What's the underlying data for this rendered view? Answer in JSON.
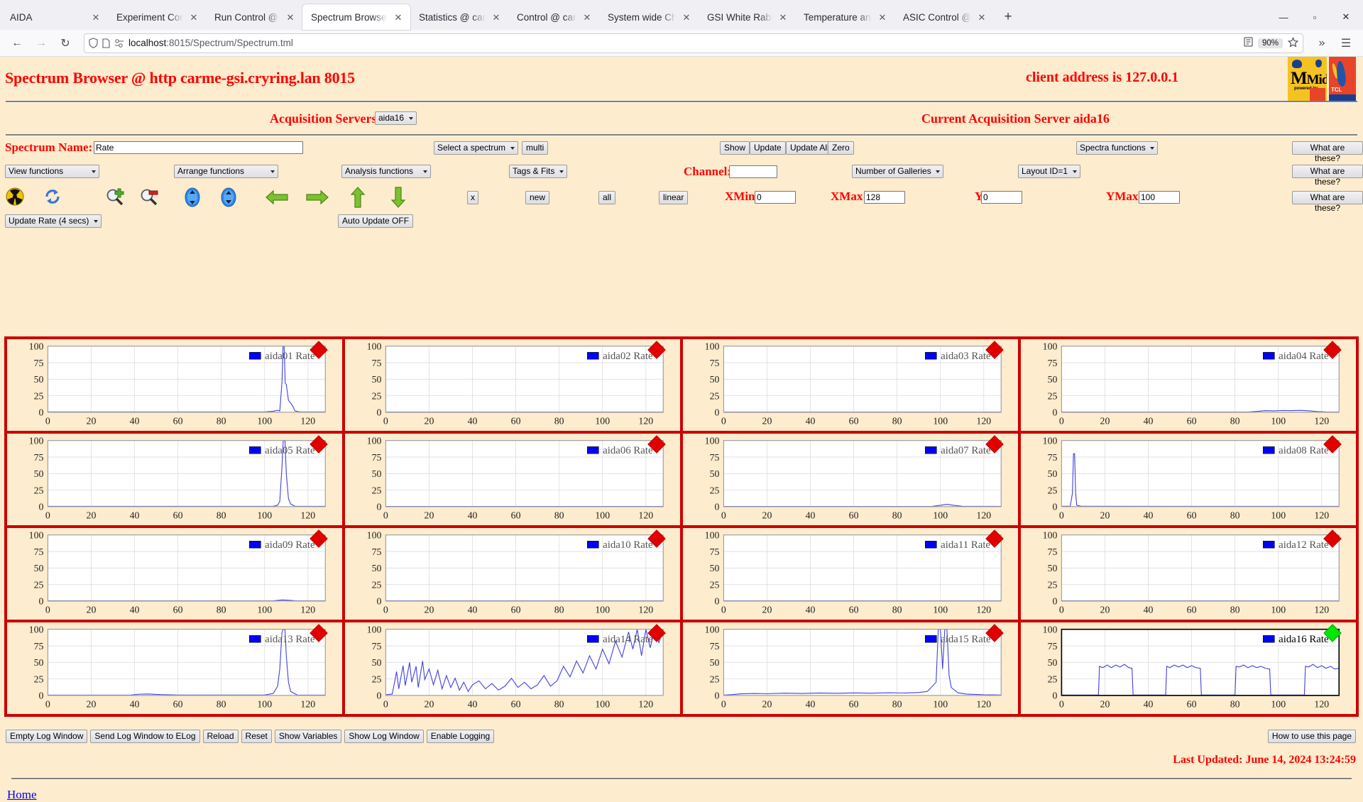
{
  "browser": {
    "tabs": [
      {
        "label": "AIDA",
        "active": false
      },
      {
        "label": "Experiment Control @",
        "active": false
      },
      {
        "label": "Run Control @ carme",
        "active": false
      },
      {
        "label": "Spectrum Browser @",
        "active": true
      },
      {
        "label": "Statistics @ carme-gs",
        "active": false
      },
      {
        "label": "Control @ carme-gsi",
        "active": false
      },
      {
        "label": "System wide Checks (",
        "active": false
      },
      {
        "label": "GSI White Rabbit Tim",
        "active": false
      },
      {
        "label": "Temperature and stat",
        "active": false
      },
      {
        "label": "ASIC Control @ carm",
        "active": false
      }
    ],
    "newtab_label": "+",
    "window_buttons": {
      "minimize": "—",
      "maximize": "▫",
      "close": "✕"
    },
    "nav": {
      "back": "←",
      "forward": "→",
      "reload": "↻"
    },
    "url": {
      "scheme_host": "localhost",
      "path": ":8015/Spectrum/Spectrum.tml"
    },
    "zoom_level": "90%",
    "overflow": "»",
    "menu": "☰"
  },
  "header": {
    "title": "Spectrum Browser @ http carme-gsi.cryring.lan 8015",
    "client_address": "client address is 127.0.0.1",
    "logo_midas": "Midas",
    "logo_midas_sub": "powered by",
    "logo_tcl": "TCL"
  },
  "acq": {
    "label": "Acquisition Servers",
    "server_selected": "aida16",
    "server_options": [
      "aida16"
    ],
    "current_label": "Current Acquisition Server aida16"
  },
  "controls": {
    "spectrum_name_label": "Spectrum Name:",
    "spectrum_name_value": "Rate",
    "spectrum_name_placeholder": "",
    "select_spectrum": "Select a spectrum",
    "multi_label": "multi",
    "show_label": "Show",
    "update_label": "Update",
    "update_all_label": "Update All",
    "zero_label": "Zero",
    "spectra_functions": "Spectra functions",
    "what_are_these": "What are these?",
    "view_functions": "View functions",
    "arrange_functions": "Arrange functions",
    "analysis_functions": "Analysis functions",
    "tags_fits": "Tags & Fits",
    "channel_label": "Channel:",
    "channel_value": "",
    "number_of_galleries": "Number of Galleries",
    "layout_id": "Layout ID=1",
    "x_label": "x",
    "new_label": "new",
    "all_label": "all",
    "linear_label": "linear",
    "xmin_label": "XMin",
    "xmin_value": "0",
    "xmax_label": "XMax",
    "xmax_value": "128",
    "ymin_label": "YMin",
    "ymin_value": "0",
    "ymax_label": "YMax",
    "ymax_value": "100",
    "update_rate": "Update Rate (4 secs)",
    "auto_update": "Auto Update OFF"
  },
  "icons": [
    "radiation-icon",
    "refresh-icon",
    "zoom-in-icon",
    "zoom-out-icon",
    "expand-down-icon",
    "expand-up-icon",
    "arrow-left-icon",
    "arrow-right-icon",
    "arrow-up-icon",
    "arrow-down-icon"
  ],
  "footer": {
    "buttons": [
      "Empty Log Window",
      "Send Log Window to ELog",
      "Reload",
      "Reset",
      "Show Variables",
      "Show Log Window",
      "Enable Logging"
    ],
    "how_to_use": "How to use this page",
    "last_updated": "Last Updated: June 14, 2024 13:24:59",
    "home_link": "Home"
  },
  "chart_data": {
    "type": "line",
    "shared": {
      "xlabel": "",
      "ylabel": "",
      "xlim": [
        0,
        128
      ],
      "ylim": [
        0,
        100
      ],
      "xticks": [
        0,
        20,
        40,
        60,
        80,
        100,
        120
      ],
      "yticks": [
        0,
        25,
        50,
        75,
        100
      ],
      "grid": true,
      "series_color": "#4040e0",
      "legend_position": "top-right"
    },
    "panels": [
      {
        "title": "aida01 Rate",
        "marker": "red",
        "selected": false,
        "points": [
          [
            0,
            0.4
          ],
          [
            100,
            0.4
          ],
          [
            104,
            1.5
          ],
          [
            106,
            3
          ],
          [
            107,
            2
          ],
          [
            108,
            45
          ],
          [
            108.5,
            100
          ],
          [
            109,
            100
          ],
          [
            109.5,
            44
          ],
          [
            110,
            42
          ],
          [
            111,
            18
          ],
          [
            112,
            14
          ],
          [
            113,
            9
          ],
          [
            114,
            2
          ],
          [
            116,
            0.4
          ],
          [
            128,
            0.4
          ]
        ]
      },
      {
        "title": "aida02 Rate",
        "marker": "red",
        "selected": false,
        "points": [
          [
            0,
            0.3
          ],
          [
            128,
            0.3
          ]
        ]
      },
      {
        "title": "aida03 Rate",
        "marker": "red",
        "selected": false,
        "points": [
          [
            0,
            0.3
          ],
          [
            128,
            0.3
          ]
        ]
      },
      {
        "title": "aida04 Rate",
        "marker": "red",
        "selected": false,
        "points": [
          [
            0,
            0.3
          ],
          [
            86,
            0.3
          ],
          [
            90,
            1.2
          ],
          [
            94,
            2.4
          ],
          [
            98,
            2.0
          ],
          [
            102,
            2.6
          ],
          [
            106,
            2.4
          ],
          [
            110,
            2.8
          ],
          [
            114,
            2.2
          ],
          [
            118,
            1.0
          ],
          [
            122,
            0.4
          ],
          [
            128,
            0.3
          ]
        ]
      },
      {
        "title": "aida05 Rate",
        "marker": "red",
        "selected": false,
        "points": [
          [
            0,
            0.4
          ],
          [
            104,
            0.4
          ],
          [
            106,
            2
          ],
          [
            107,
            8
          ],
          [
            108,
            60
          ],
          [
            108.6,
            100
          ],
          [
            109.4,
            100
          ],
          [
            110,
            50
          ],
          [
            111,
            12
          ],
          [
            112,
            4
          ],
          [
            114,
            0.5
          ],
          [
            128,
            0.4
          ]
        ]
      },
      {
        "title": "aida06 Rate",
        "marker": "red",
        "selected": false,
        "points": [
          [
            0,
            0.3
          ],
          [
            128,
            0.3
          ]
        ]
      },
      {
        "title": "aida07 Rate",
        "marker": "red",
        "selected": false,
        "points": [
          [
            0,
            0.3
          ],
          [
            96,
            0.3
          ],
          [
            100,
            2.0
          ],
          [
            103,
            3.5
          ],
          [
            106,
            2.0
          ],
          [
            110,
            0.6
          ],
          [
            128,
            0.3
          ]
        ]
      },
      {
        "title": "aida08 Rate",
        "marker": "red",
        "selected": false,
        "points": [
          [
            0,
            0.5
          ],
          [
            4,
            0.5
          ],
          [
            5,
            20
          ],
          [
            5.5,
            80
          ],
          [
            6,
            80
          ],
          [
            6.5,
            20
          ],
          [
            7,
            2
          ],
          [
            9,
            0.5
          ],
          [
            128,
            0.4
          ]
        ]
      },
      {
        "title": "aida09 Rate",
        "marker": "red",
        "selected": false,
        "points": [
          [
            0,
            0.3
          ],
          [
            104,
            0.3
          ],
          [
            108,
            1.6
          ],
          [
            111,
            1.2
          ],
          [
            114,
            0.4
          ],
          [
            128,
            0.3
          ]
        ]
      },
      {
        "title": "aida10 Rate",
        "marker": "red",
        "selected": false,
        "points": [
          [
            0,
            0.3
          ],
          [
            128,
            0.3
          ]
        ]
      },
      {
        "title": "aida11 Rate",
        "marker": "red",
        "selected": false,
        "points": [
          [
            0,
            0.3
          ],
          [
            128,
            0.3
          ]
        ]
      },
      {
        "title": "aida12 Rate",
        "marker": "red",
        "selected": false,
        "points": [
          [
            0,
            0.3
          ],
          [
            128,
            0.3
          ]
        ]
      },
      {
        "title": "aida13 Rate",
        "marker": "red",
        "selected": false,
        "points": [
          [
            0,
            0.4
          ],
          [
            38,
            0.4
          ],
          [
            42,
            1.8
          ],
          [
            46,
            2.2
          ],
          [
            52,
            1.2
          ],
          [
            60,
            0.6
          ],
          [
            100,
            0.5
          ],
          [
            104,
            3
          ],
          [
            106,
            14
          ],
          [
            107,
            40
          ],
          [
            108,
            95
          ],
          [
            108.6,
            100
          ],
          [
            109.4,
            100
          ],
          [
            110,
            60
          ],
          [
            111,
            20
          ],
          [
            112,
            6
          ],
          [
            115,
            0.6
          ],
          [
            128,
            0.4
          ]
        ]
      },
      {
        "title": "aida14 Rate",
        "marker": "red",
        "selected": false,
        "points": [
          [
            0,
            1
          ],
          [
            3,
            2
          ],
          [
            5,
            36
          ],
          [
            6,
            10
          ],
          [
            8,
            45
          ],
          [
            9,
            15
          ],
          [
            11,
            50
          ],
          [
            12,
            20
          ],
          [
            14,
            44
          ],
          [
            15,
            12
          ],
          [
            17,
            52
          ],
          [
            18,
            24
          ],
          [
            20,
            40
          ],
          [
            22,
            16
          ],
          [
            24,
            38
          ],
          [
            26,
            10
          ],
          [
            28,
            30
          ],
          [
            30,
            12
          ],
          [
            32,
            26
          ],
          [
            34,
            8
          ],
          [
            36,
            20
          ],
          [
            38,
            6
          ],
          [
            40,
            16
          ],
          [
            43,
            22
          ],
          [
            46,
            10
          ],
          [
            49,
            18
          ],
          [
            52,
            8
          ],
          [
            55,
            14
          ],
          [
            58,
            26
          ],
          [
            61,
            12
          ],
          [
            64,
            20
          ],
          [
            67,
            10
          ],
          [
            70,
            16
          ],
          [
            73,
            30
          ],
          [
            76,
            14
          ],
          [
            79,
            22
          ],
          [
            82,
            44
          ],
          [
            85,
            28
          ],
          [
            88,
            52
          ],
          [
            91,
            34
          ],
          [
            94,
            60
          ],
          [
            97,
            40
          ],
          [
            100,
            70
          ],
          [
            103,
            48
          ],
          [
            106,
            82
          ],
          [
            109,
            58
          ],
          [
            112,
            96
          ],
          [
            114,
            70
          ],
          [
            116,
            100
          ],
          [
            118,
            60
          ],
          [
            120,
            100
          ],
          [
            122,
            72
          ],
          [
            124,
            100
          ],
          [
            126,
            80
          ],
          [
            128,
            100
          ]
        ]
      },
      {
        "title": "aida15 Rate",
        "marker": "red",
        "selected": false,
        "points": [
          [
            0,
            0.4
          ],
          [
            4,
            1.2
          ],
          [
            8,
            2.4
          ],
          [
            14,
            3.0
          ],
          [
            20,
            2.6
          ],
          [
            28,
            3.4
          ],
          [
            36,
            3.0
          ],
          [
            44,
            3.6
          ],
          [
            52,
            3.2
          ],
          [
            60,
            3.8
          ],
          [
            68,
            3.4
          ],
          [
            76,
            4.0
          ],
          [
            84,
            3.6
          ],
          [
            90,
            4.4
          ],
          [
            94,
            6
          ],
          [
            98,
            20
          ],
          [
            99,
            100
          ],
          [
            100,
            100
          ],
          [
            101,
            40
          ],
          [
            102,
            100
          ],
          [
            103,
            100
          ],
          [
            104,
            30
          ],
          [
            105,
            12
          ],
          [
            108,
            4
          ],
          [
            112,
            2
          ],
          [
            120,
            1
          ],
          [
            128,
            0.6
          ]
        ]
      },
      {
        "title": "aida16 Rate",
        "marker": "green",
        "selected": true,
        "points": [
          [
            0,
            0.5
          ],
          [
            17,
            0.5
          ],
          [
            17.5,
            44
          ],
          [
            19,
            42
          ],
          [
            21,
            46
          ],
          [
            23,
            42
          ],
          [
            25,
            46
          ],
          [
            27,
            43
          ],
          [
            29,
            47
          ],
          [
            31,
            42
          ],
          [
            32.5,
            41
          ],
          [
            33,
            0.5
          ],
          [
            48,
            0.5
          ],
          [
            48.5,
            44
          ],
          [
            50,
            42
          ],
          [
            52,
            46
          ],
          [
            54,
            43
          ],
          [
            56,
            46
          ],
          [
            58,
            42
          ],
          [
            60,
            45
          ],
          [
            62,
            42
          ],
          [
            64,
            41
          ],
          [
            64.5,
            0.5
          ],
          [
            80,
            0.5
          ],
          [
            80.5,
            44
          ],
          [
            82,
            43
          ],
          [
            84,
            46
          ],
          [
            86,
            42
          ],
          [
            88,
            45
          ],
          [
            90,
            42
          ],
          [
            92,
            44
          ],
          [
            94,
            41
          ],
          [
            96,
            40
          ],
          [
            96.5,
            0.5
          ],
          [
            112,
            0.5
          ],
          [
            112.5,
            44
          ],
          [
            114,
            43
          ],
          [
            116,
            47
          ],
          [
            118,
            42
          ],
          [
            120,
            45
          ],
          [
            122,
            41
          ],
          [
            124,
            44
          ],
          [
            126,
            40
          ],
          [
            128,
            41
          ]
        ]
      }
    ]
  }
}
